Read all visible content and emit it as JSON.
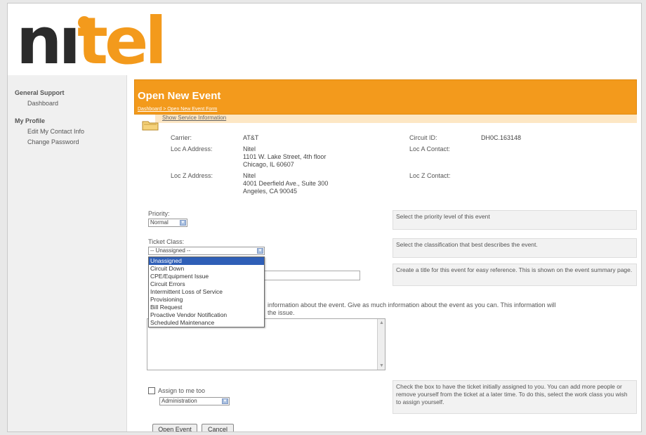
{
  "logo": {
    "part1": "n",
    "part2": "tel"
  },
  "sidebar": {
    "section1": "General Support",
    "item1": "Dashboard",
    "section2": "My Profile",
    "item2": "Edit My Contact Info",
    "item3": "Change Password"
  },
  "header": {
    "title": "Open New Event",
    "breadcrumb": "Dashboard > Open New Event Form"
  },
  "sub_link": "Show Service Information",
  "circuit": {
    "carrier_label": "Carrier:",
    "carrier_value": "AT&T",
    "circuit_label": "Circuit ID:",
    "circuit_value": "DH0C.163148",
    "loc_a_label": "Loc A Address:",
    "loc_a_value": [
      "Nitel",
      "1101 W. Lake Street, 4th floor",
      "Chicago, IL 60607"
    ],
    "loc_a_contact_label": "Loc A Contact:",
    "loc_z_label": "Loc Z Address:",
    "loc_z_value": [
      "Nitel",
      "4001 Deerfield Ave., Suite 300",
      "Angeles, CA 90045"
    ],
    "loc_z_contact_label": "Loc Z Contact:"
  },
  "form": {
    "priority_label": "Priority:",
    "priority_value": "Normal",
    "classification_label": "Ticket Class:",
    "classification_value": "-- Unassigned --",
    "classification_options": [
      "Unassigned",
      "Circuit Down",
      "CPE/Equipment Issue",
      "Circuit Errors",
      "Intermittent Loss of Service",
      "Provisioning",
      "Bill Request",
      "Proactive Vendor Notification",
      "Scheduled Maintenance"
    ],
    "description_partial": "information about the event. Give as much information about the event as you can. This information will",
    "description_partial2": "the issue.",
    "assign_label": "Assign to me too",
    "assign_value": "Administration",
    "open_button": "Open Event",
    "cancel_button": "Cancel"
  },
  "help": {
    "priority": "Select the priority level of this event",
    "classification": "Select the classification that best describes the event.",
    "subject": "Create a title for this event for easy reference. This is shown on the event summary page.",
    "assign": "Check the box to have the ticket initially assigned to you. You can add more people or remove yourself from the ticket at a later time. To do this, select the work class you wish to assign yourself."
  },
  "colors": {
    "accent": "#f39a1c",
    "selection": "#2f5fb7"
  }
}
